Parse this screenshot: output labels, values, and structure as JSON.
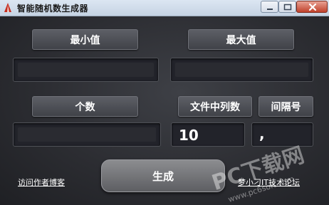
{
  "window": {
    "title": "智能随机数生成器"
  },
  "labels": {
    "min": "最小值",
    "max": "最大值",
    "count": "个数",
    "columns": "文件中列数",
    "separator": "间隔号"
  },
  "fields": {
    "min": "",
    "max": "",
    "count": "",
    "columns": "10",
    "separator": ","
  },
  "generate_label": "生成",
  "links": {
    "author_blog": "访问作者博客",
    "forum": "梦小刁IT技术论坛"
  },
  "watermark": {
    "main": "PC下载网",
    "sub": "www.pc6soft.com"
  },
  "colors": {
    "label_button": "#4c4e55",
    "input_background": "#22232a",
    "text": "#ffffff",
    "close_button": "#c0412b"
  }
}
